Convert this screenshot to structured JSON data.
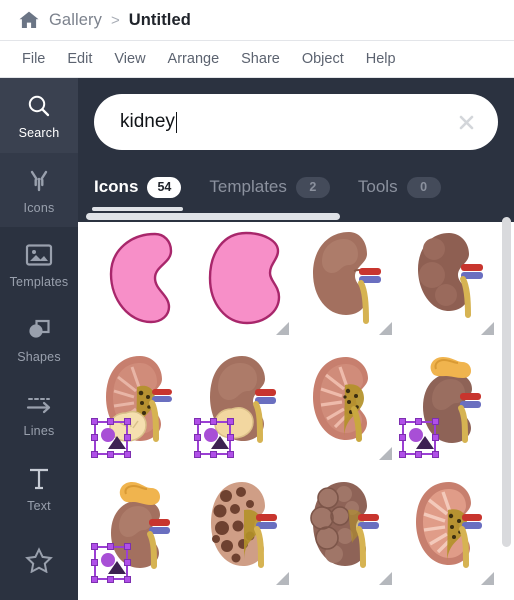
{
  "breadcrumb": {
    "home_icon": "home-icon",
    "parent": "Gallery",
    "separator": ">",
    "current": "Untitled"
  },
  "menu": {
    "items": [
      {
        "label": "File"
      },
      {
        "label": "Edit"
      },
      {
        "label": "View"
      },
      {
        "label": "Arrange"
      },
      {
        "label": "Share"
      },
      {
        "label": "Object"
      },
      {
        "label": "Help"
      }
    ]
  },
  "sidebar": {
    "items": [
      {
        "label": "Search",
        "icon": "magnifier-icon",
        "state": "active"
      },
      {
        "label": "Icons",
        "icon": "antibody-icon",
        "state": "subtle"
      },
      {
        "label": "Templates",
        "icon": "image-icon",
        "state": "normal"
      },
      {
        "label": "Shapes",
        "icon": "shapes-icon",
        "state": "normal"
      },
      {
        "label": "Lines",
        "icon": "dashed-arrow-icon",
        "state": "normal"
      },
      {
        "label": "Text",
        "icon": "text-t-icon",
        "state": "normal"
      },
      {
        "label": "",
        "icon": "star-icon",
        "state": "normal"
      }
    ]
  },
  "search": {
    "value": "kidney",
    "placeholder": "Search",
    "clear_icon": "close-x-icon",
    "has_caret": true
  },
  "tabs": [
    {
      "label": "Icons",
      "count": "54",
      "active": true
    },
    {
      "label": "Templates",
      "count": "2",
      "active": false
    },
    {
      "label": "Tools",
      "count": "0",
      "active": false
    }
  ],
  "results": {
    "scrollbar_vertical": "results-vertical-scrollbar",
    "scrollbar_horizontal": "tabs-horizontal-scrollbar",
    "items": [
      {
        "art": "kidney-outline-pink-a",
        "selected": false,
        "resize_corner": false
      },
      {
        "art": "kidney-outline-pink-b",
        "selected": false,
        "resize_corner": true
      },
      {
        "art": "kidney-anatomical-a",
        "selected": false,
        "resize_corner": true
      },
      {
        "art": "kidney-anatomical-b",
        "selected": false,
        "resize_corner": true
      },
      {
        "art": "kidney-cross-section-stone",
        "selected": true,
        "resize_corner": false
      },
      {
        "art": "kidney-with-tumor",
        "selected": true,
        "resize_corner": false
      },
      {
        "art": "kidney-cross-section",
        "selected": false,
        "resize_corner": true
      },
      {
        "art": "kidney-adrenal-gland-a",
        "selected": true,
        "resize_corner": false
      },
      {
        "art": "kidney-adrenal-gland-b",
        "selected": true,
        "resize_corner": false
      },
      {
        "art": "kidney-polycystic",
        "selected": false,
        "resize_corner": true
      },
      {
        "art": "kidney-lumpy-diseased",
        "selected": false,
        "resize_corner": true
      },
      {
        "art": "kidney-cross-section-c",
        "selected": false,
        "resize_corner": true
      }
    ]
  },
  "colors": {
    "panel_dark": "#2b3240",
    "rail_active": "#3a4150",
    "accent_selection": "#9b3fd4",
    "badge_active_bg": "#ffffff",
    "kidney_pink": "#f78fc8",
    "kidney_brown": "#a3705f",
    "artery_red": "#c8352e",
    "vein_blue": "#6a6fc0",
    "ureter_yellow": "#d6b352"
  }
}
